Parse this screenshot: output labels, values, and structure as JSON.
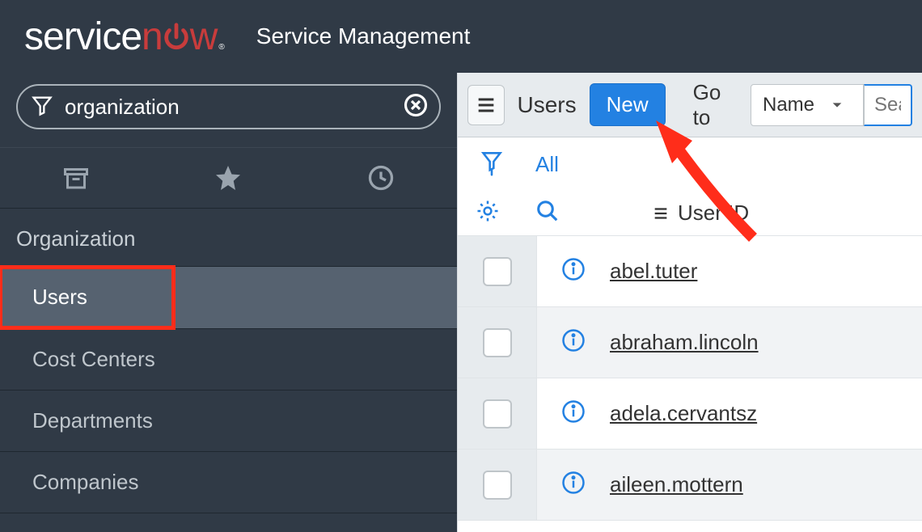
{
  "header": {
    "logo_service": "service",
    "logo_now_n": "n",
    "logo_now_w": "w",
    "logo_tm": "®",
    "app_title": "Service Management"
  },
  "sidebar": {
    "filter_value": "organization",
    "section_title": "Organization",
    "items": [
      {
        "label": "Users",
        "active": true
      },
      {
        "label": "Cost Centers",
        "active": false
      },
      {
        "label": "Departments",
        "active": false
      },
      {
        "label": "Companies",
        "active": false
      }
    ]
  },
  "content": {
    "page_title": "Users",
    "new_button": "New",
    "goto_label": "Go to",
    "select_value": "Name",
    "search_placeholder": "Search",
    "all_label": "All",
    "column_header": "User ID",
    "rows": [
      {
        "user_id": "abel.tuter"
      },
      {
        "user_id": "abraham.lincoln"
      },
      {
        "user_id": "adela.cervantsz"
      },
      {
        "user_id": "aileen.mottern"
      }
    ]
  },
  "colors": {
    "accent": "#2381e2",
    "annotation": "#ff2d1a"
  }
}
